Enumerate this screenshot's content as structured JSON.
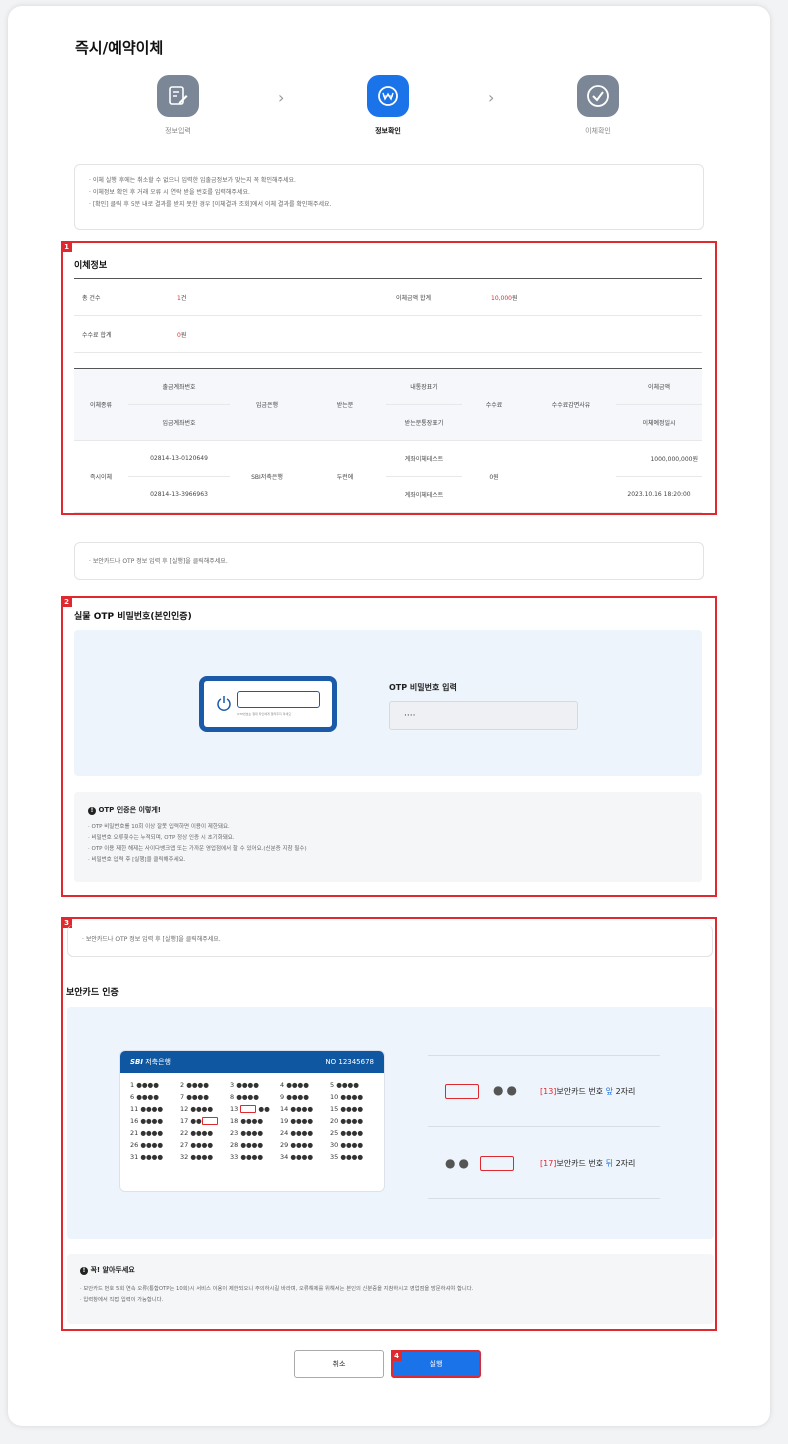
{
  "page_title": "즉시/예약이체",
  "steps": [
    {
      "label": "정보입력",
      "icon": "edit-icon",
      "active": false
    },
    {
      "label": "정보확인",
      "icon": "won-check-icon",
      "active": true
    },
    {
      "label": "이체확인",
      "icon": "check-circle-icon",
      "active": false
    }
  ],
  "top_notice": [
    "· 이체 실행 후에는 취소할 수 없으니 입력한 입출금정보가 맞는지 꼭 확인해주세요.",
    "· 이체정보 확인 후 거래 오류 시 연락 받을 번호를 입력해주세요.",
    "· [확인] 클릭 후 5분 내로 결과를 받지 못한 경우 [이체결과 조회]에서 이체 결과를 확인해주세요."
  ],
  "section1": {
    "tag": "1",
    "title": "이체정보",
    "summary": {
      "count_label": "총 건수",
      "count_num": "1",
      "count_unit": "건",
      "amount_label": "이체금액 합계",
      "amount_num": "10,000",
      "amount_unit": "원",
      "fee_label": "수수료 합계",
      "fee_num": "0",
      "fee_unit": "원"
    },
    "headers": {
      "type": "이체종류",
      "from_acct": "출금계좌번호",
      "to_acct": "입금계좌번호",
      "bank": "입금은행",
      "receiver": "받는분",
      "my_memo": "내통장표기",
      "their_memo": "받는분통장표기",
      "fee": "수수료",
      "fee_reason": "수수료감면사유",
      "amount": "이체금액",
      "schedule": "이체예정일시"
    },
    "row": {
      "type": "즉시이체",
      "from_acct": "02814-13-0120649",
      "to_acct": "02814-13-3966963",
      "bank": "SBI저축은행",
      "receiver": "두런에",
      "my_memo": "계좌이체테스트",
      "their_memo": "계좌이체테스트",
      "fee": "0원",
      "fee_reason": "",
      "amount": "1000,000,000원",
      "schedule": "2023.10.16 18:20:00"
    }
  },
  "middle_notice": "· 보안카드나 OTP 정보 입력 후 [실행]을 클릭해주세요.",
  "section2": {
    "tag": "2",
    "title": "실물 OTP 비밀번호(본인인증)",
    "device_caption": "OTP번호는 절대 타인에게 알려주지 마세요",
    "otp_label": "OTP 비밀번호 입력",
    "otp_value": "····",
    "info_title": "OTP 인증은 이렇게!",
    "info_lines": [
      "· OTP 비밀번호를 10회 이상 잘못 입력하면 이용이 제한돼요.",
      "· 비밀번호 오류횟수는 누적되며, OTP 정상 인증 시 초기화돼요.",
      "· OTP 이용 제한 해제는 사이다뱅크앱 또는 가까운 영업점에서 할 수 있어요.(신분증 지참 필수)",
      "· 비밀번호 입력 후 [실행]을 클릭해주세요."
    ]
  },
  "section3": {
    "tag": "3",
    "notice": "· 보안카드나 OTP 정보 입력 후 [실행]을 클릭해주세요.",
    "title": "보안카드 인증",
    "card": {
      "brand": "SBI",
      "bank": "저축은행",
      "no": "NO 12345678",
      "cells": [
        "1 ●●●●",
        "2 ●●●●",
        "3 ●●●●",
        "4 ●●●●",
        "5 ●●●●",
        "6 ●●●●",
        "7 ●●●●",
        "8 ●●●●",
        "9 ●●●●",
        "10 ●●●●",
        "11 ●●●●",
        "12 ●●●●",
        "13 ",
        "14 ●●●●",
        "15 ●●●●",
        "16 ●●●●",
        "17 ●●",
        "18 ●●●●",
        "19 ●●●●",
        "20 ●●●●",
        "21 ●●●●",
        "22 ●●●●",
        "23 ●●●●",
        "24 ●●●●",
        "25 ●●●●",
        "26 ●●●●",
        "27 ●●●●",
        "28 ●●●●",
        "29 ●●●●",
        "30 ●●●●",
        "31 ●●●●",
        "32 ●●●●",
        "33 ●●●●",
        "34 ●●●●",
        "35 ●●●●"
      ]
    },
    "row1": {
      "num": "[13]",
      "text1": "보안카드 번호 ",
      "pos": "앞",
      "text2": " 2자리",
      "dots": "●●"
    },
    "row2": {
      "num": "[17]",
      "text1": "보안카드 번호 ",
      "pos": "뒤",
      "text2": " 2자리",
      "dots": "●●"
    },
    "info_title": "꼭! 알아두세요",
    "info_lines": [
      "· 보안카드 번호 5회 연속 오류(통합OTP는 10회)시 서비스 이용이 제한되오니 주의하시길 바라며, 오류해제를 위해서는 본인의 신분증을 지참하시고 영업점을 방문하셔야 합니다.",
      "· 입력창에서 직접 입력이 가능합니다."
    ]
  },
  "buttons": {
    "cancel": "취소",
    "execute": "실행",
    "tag": "4"
  },
  "colors": {
    "accent": "#1a73e8",
    "highlight": "#e0292f",
    "step_inactive": "#7b8796",
    "step_active": "#1a73e8"
  }
}
